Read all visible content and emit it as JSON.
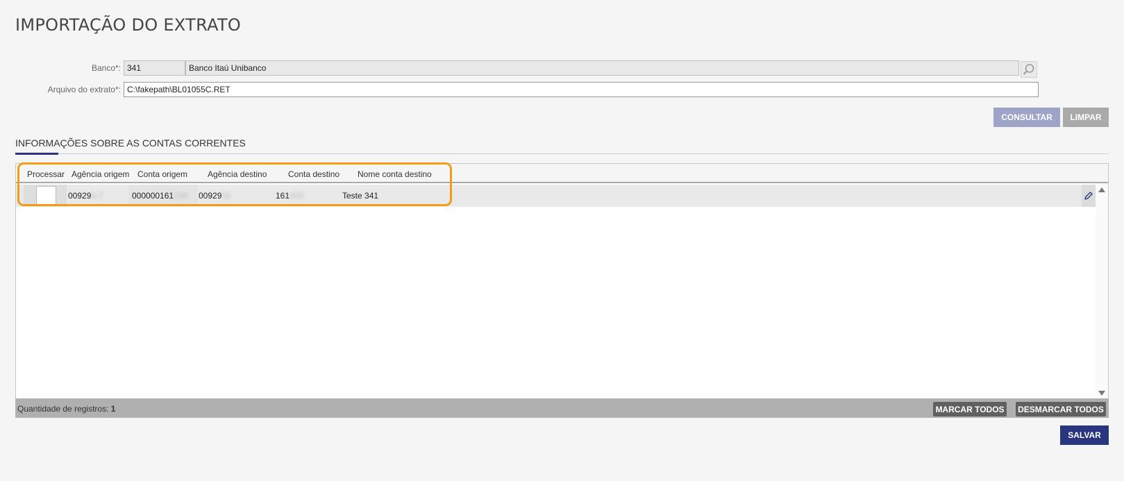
{
  "page": {
    "title": "IMPORTAÇÃO DO EXTRATO"
  },
  "form": {
    "banco_label": "Banco*:",
    "banco_code": "341",
    "banco_name": "Banco Itaú Unibanco",
    "arquivo_label": "Arquivo do extrato*:",
    "arquivo_value": "C:\\fakepath\\BL01055C.RET",
    "search_icon": "search-icon"
  },
  "actions": {
    "consultar": "CONSULTAR",
    "limpar": "LIMPAR",
    "salvar": "SALVAR"
  },
  "section": {
    "title": "INFORMAÇÕES SOBRE AS CONTAS CORRENTES"
  },
  "table": {
    "columns": [
      "Processar",
      "Agência origem",
      "Conta origem",
      "Agência destino",
      "Conta destino",
      "Nome conta destino"
    ],
    "rows": [
      {
        "agencia_origem": "00929",
        "agencia_origem_hidden": "0-7",
        "conta_origem": "000000161",
        "conta_origem_hidden": "234",
        "agencia_destino": "00929",
        "agencia_destino_hidden": "01",
        "conta_destino": "161",
        "conta_destino_hidden": "456",
        "nome_conta_destino": "Teste 341"
      }
    ]
  },
  "footer": {
    "count_label": "Quantidade de registros:",
    "count_value": "1",
    "marcar": "MARCAR TODOS",
    "desmarcar": "DESMARCAR TODOS"
  },
  "colors": {
    "primary": "#2a3580",
    "primary_disabled": "#9ea4c8",
    "highlight": "#f29d16"
  }
}
